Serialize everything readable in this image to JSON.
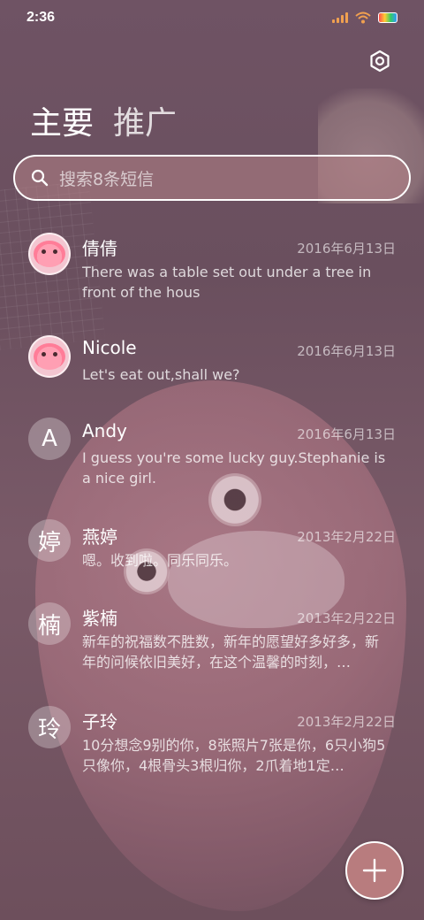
{
  "status_bar": {
    "time": "2:36"
  },
  "header": {
    "tabs": [
      {
        "label": "主要",
        "active": true
      },
      {
        "label": "推广",
        "active": false
      }
    ],
    "settings_icon": "gear-icon"
  },
  "search": {
    "placeholder": "搜索8条短信",
    "icon": "search-icon"
  },
  "conversations": [
    {
      "name": "倩倩",
      "date": "2016年6月13日",
      "snippet": "There was a table set out under a tree in front of the hous",
      "avatar_type": "image",
      "avatar_text": ""
    },
    {
      "name": "Nicole",
      "date": "2016年6月13日",
      "snippet": "Let's eat out,shall we?",
      "avatar_type": "image",
      "avatar_text": ""
    },
    {
      "name": "Andy",
      "date": "2016年6月13日",
      "snippet": "I guess you're some lucky guy.Stephanie is a nice girl.",
      "avatar_type": "letter",
      "avatar_text": "A"
    },
    {
      "name": "燕婷",
      "date": "2013年2月22日",
      "snippet": "嗯。收到啦。同乐同乐。",
      "avatar_type": "letter",
      "avatar_text": "婷"
    },
    {
      "name": "紫楠",
      "date": "2013年2月22日",
      "snippet": "新年的祝福数不胜数，新年的愿望好多好多，新年的问候依旧美好，在这个温馨的时刻，…",
      "avatar_type": "letter",
      "avatar_text": "楠"
    },
    {
      "name": "子玲",
      "date": "2013年2月22日",
      "snippet": "10分想念9别的你，8张照片7张是你，6只小狗5只像你，4根骨头3根归你，2爪着地1定…",
      "avatar_type": "letter",
      "avatar_text": "玲"
    }
  ],
  "fab": {
    "icon": "plus-icon"
  },
  "colors": {
    "background": "#6e5260",
    "fab": "#b87c7e",
    "search_fill": "#b48287"
  }
}
